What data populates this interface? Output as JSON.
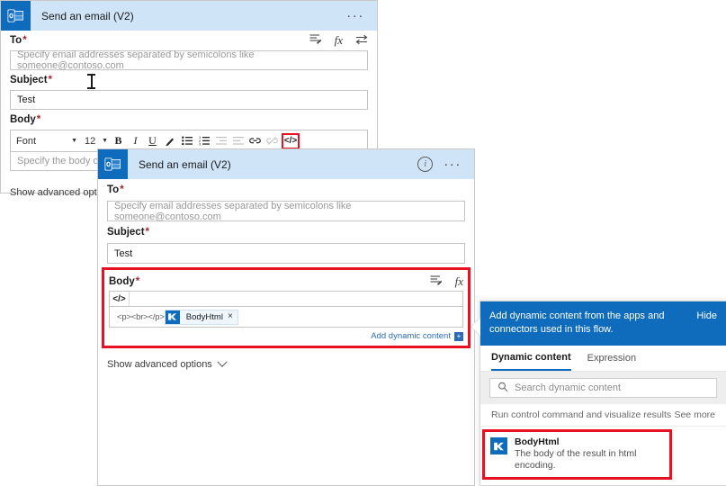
{
  "panel1": {
    "header": {
      "icon": "outlook-icon",
      "title": "Send an email (V2)",
      "more_label": "···"
    },
    "to": {
      "label": "To",
      "required": "*",
      "placeholder": "Specify email addresses separated by semicolons like someone@contoso.com",
      "value": "",
      "icons": [
        "add-dynamic-content-icon",
        "function-fx-icon",
        "switch-inputs-icon"
      ]
    },
    "subject": {
      "label": "Subject",
      "required": "*",
      "value": "Test"
    },
    "body": {
      "label": "Body",
      "required": "*",
      "placeholder": "Specify the body of the mail"
    },
    "toolbar": {
      "font_label": "Font",
      "size_label": "12",
      "bold": "B",
      "italic": "I",
      "underline": "U",
      "text_color": "text-color-icon",
      "bulleted_list": "bulleted-list-icon",
      "numbered_list": "numbered-list-icon",
      "outdent": "outdent-icon",
      "indent": "indent-icon",
      "link": "link-icon",
      "unlink": "unlink-icon",
      "code_view": "</>"
    },
    "advanced_options": "Show advanced options"
  },
  "panel2": {
    "header": {
      "icon": "outlook-icon",
      "title": "Send an email (V2)",
      "info_label": "i",
      "more_label": "···"
    },
    "to": {
      "label": "To",
      "required": "*",
      "placeholder": "Specify email addresses separated by semicolons like someone@contoso.com"
    },
    "subject": {
      "label": "Subject",
      "required": "*",
      "value": "Test"
    },
    "body": {
      "label": "Body",
      "required": "*",
      "code_glyph": "</>",
      "raw_html": "<p><br></p>",
      "token_label": "BodyHtml",
      "token_remove": "×",
      "add_dynamic_content": "Add dynamic content",
      "add_dynamic_content_badge": "+",
      "icons": [
        "add-dynamic-content-icon",
        "function-fx-icon"
      ]
    },
    "advanced_options": "Show advanced options"
  },
  "dynamic_panel": {
    "header_text": "Add dynamic content from the apps and connectors used in this flow.",
    "hide_label": "Hide",
    "tabs": [
      {
        "label": "Dynamic content",
        "active": true
      },
      {
        "label": "Expression",
        "active": false
      }
    ],
    "search_placeholder": "Search dynamic content",
    "group": {
      "title": "Run control command and visualize results",
      "see_more": "See more"
    },
    "item": {
      "name": "BodyHtml",
      "description": "The body of the result in html encoding.",
      "icon": "kusto-icon"
    }
  },
  "colors": {
    "accent_blue": "#0f6cbd",
    "header_blue": "#cfe4f7",
    "highlight_red": "#e81123",
    "link_blue": "#2b6cb8"
  }
}
